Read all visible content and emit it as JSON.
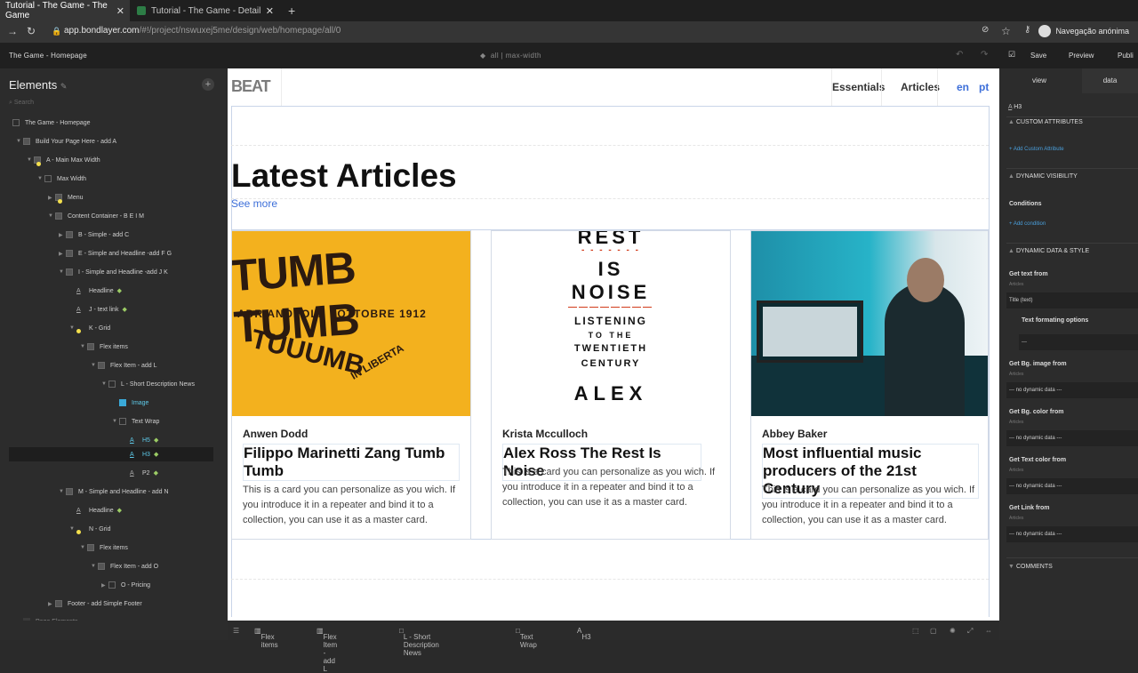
{
  "browser": {
    "tabs": [
      {
        "title": "Tutorial - The Game - The Game",
        "close": "✕"
      },
      {
        "title": "Tutorial - The Game - Detail",
        "close": "✕"
      }
    ],
    "new_tab": "+",
    "url_host": "app.bondlayer.com",
    "url_path": "/#!/project/nswuxej5me/design/web/homepage/all/0",
    "incognito_label": "Navegação anónima"
  },
  "appbar": {
    "page_name": "The Game - Homepage",
    "breakpoint": "all | max-width",
    "save": "Save",
    "preview": "Preview",
    "publish": "Publi"
  },
  "elements_panel": {
    "title": "Elements",
    "search_placeholder": "Search",
    "tree": [
      {
        "label": "The Game - Homepage"
      },
      {
        "label": "Build Your Page Here - add A"
      },
      {
        "label": "A - Main Max Width"
      },
      {
        "label": "Max Width"
      },
      {
        "label": "Menu"
      },
      {
        "label": "Content Container - B E I M"
      },
      {
        "label": "B - Simple - add C"
      },
      {
        "label": "E - Simple and Headline -add F G"
      },
      {
        "label": "I - Simple and Headline -add J K"
      },
      {
        "label": "Headline"
      },
      {
        "label": "J - text link"
      },
      {
        "label": "K - Grid"
      },
      {
        "label": "Flex items"
      },
      {
        "label": "Flex Item - add L"
      },
      {
        "label": "L - Short Description News"
      },
      {
        "label": "Image"
      },
      {
        "label": "Text Wrap"
      },
      {
        "label": "H5"
      },
      {
        "label": "H3"
      },
      {
        "label": "P2"
      },
      {
        "label": "M - Simple and Headline - add N"
      },
      {
        "label": "Headline"
      },
      {
        "label": "N - Grid"
      },
      {
        "label": "Flex items"
      },
      {
        "label": "Flex Item - add O"
      },
      {
        "label": "O - Pricing"
      },
      {
        "label": "Footer - add Simple Footer"
      },
      {
        "label": "Page Elements"
      }
    ]
  },
  "site": {
    "logo": "BEAT",
    "menu": [
      "Essentials",
      "Articles"
    ],
    "langs": [
      "en",
      "pt"
    ],
    "headline": "Latest Articles",
    "see_more": "See more",
    "cards": [
      {
        "author": "Anwen Dodd",
        "title": "Filippo Marinetti Zang Tumb Tumb",
        "desc": "This is a card you can personalize as you wich. If you introduce it in a repeater and bind it to a collection, you can use it as a master card."
      },
      {
        "author": "Krista Mcculloch",
        "title": "Alex Ross The Rest Is Noise",
        "desc": "This is a card you can personalize as you wich. If you introduce it in a repeater and bind it to a collection, you can use it as a master card."
      },
      {
        "author": "Abbey Baker",
        "title": "Most influential music producers of the 21st Century",
        "desc": "This is a card you can personalize as you wich. If you introduce it in a repeater and bind it to a collection, you can use it as a master card."
      }
    ],
    "poster1": {
      "line1": "TUMB TUMB",
      "line2": "ADRIANOPOLI    OTTOBRE 1912",
      "line3": "TUUUMB",
      "line4": "IN LIBERTA"
    },
    "poster2": {
      "lines": [
        "REST",
        "IS",
        "NOISE",
        "LISTENING",
        "TO THE",
        "TWENTIETH",
        "CENTURY",
        "ALEX"
      ]
    }
  },
  "statusbar": {
    "crumbs": [
      "Flex items",
      "Flex Item - add L",
      "L - Short Description News",
      "Text Wrap",
      "H3"
    ]
  },
  "right_panel": {
    "tabs": [
      "view",
      "data"
    ],
    "element": "H3",
    "custom_attributes": "CUSTOM ATTRIBUTES",
    "add_custom": "+ Add Custom Attribute",
    "dynamic_visibility": "DYNAMIC VISIBILITY",
    "conditions": "Conditions",
    "add_condition": "+ Add condition",
    "dynamic_data": "DYNAMIC DATA & STYLE",
    "get_text_from": "Get text from",
    "articles": "Articles",
    "title_text": "Title (text)",
    "text_formatting": "Text formating options",
    "dashes": "---",
    "get_bg_image": "Get Bg. image from",
    "get_bg_color": "Get Bg. color from",
    "get_text_color": "Get Text color from",
    "get_link": "Get Link from",
    "no_dynamic": "--- no dynamic data ---",
    "comments": "COMMENTS"
  }
}
